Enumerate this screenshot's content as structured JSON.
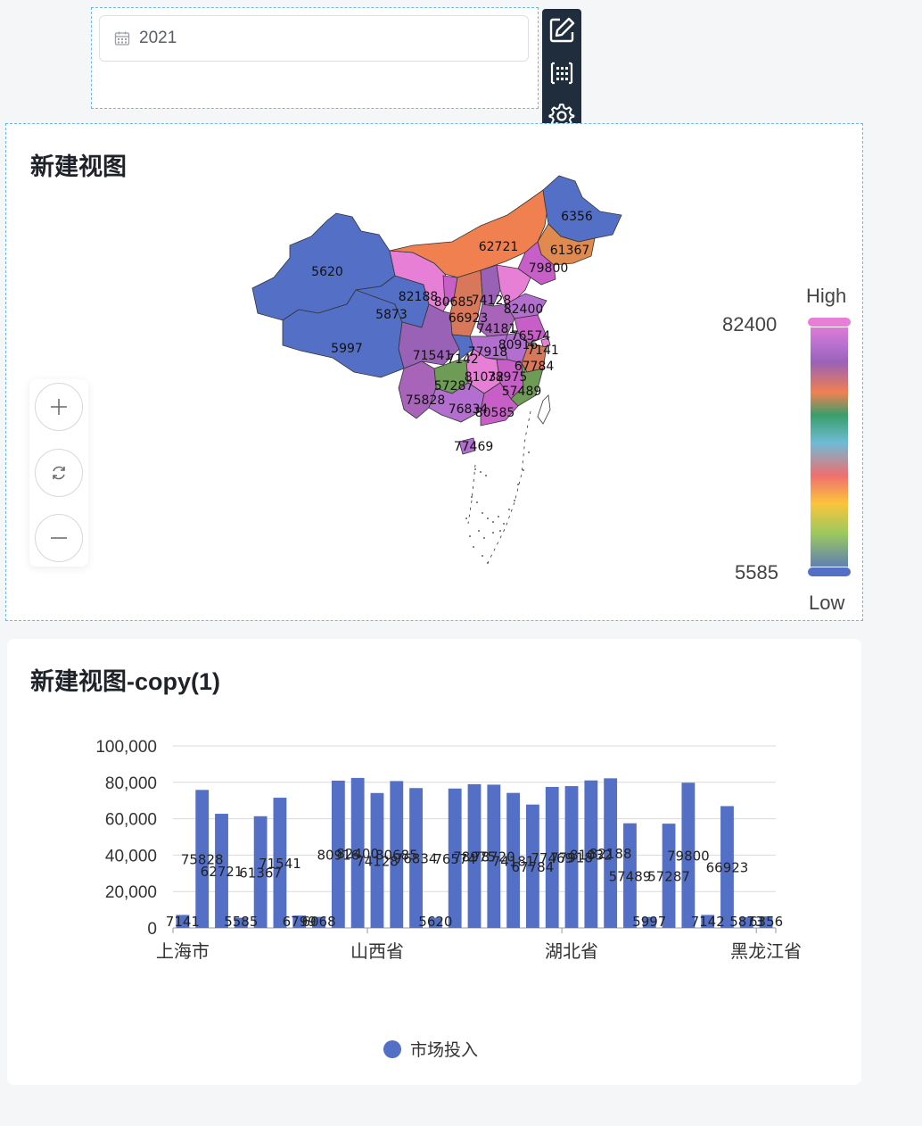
{
  "filter": {
    "date_value": "2021"
  },
  "map_card": {
    "title": "新建视图",
    "visual_map": {
      "high_label": "High",
      "low_label": "Low",
      "max": "82400",
      "min": "5585"
    },
    "region_labels": [
      {
        "text": "6356",
        "fill": "#5470c6"
      },
      {
        "text": "62721",
        "fill": "#f08050"
      },
      {
        "text": "61367",
        "fill": "#e08a50"
      },
      {
        "text": "79800",
        "fill": "#c85fc8"
      },
      {
        "text": "5620",
        "fill": "#5470c6"
      },
      {
        "text": "82188",
        "fill": "#e87fd6"
      },
      {
        "text": "5873",
        "fill": "#5470c6"
      },
      {
        "text": "80685",
        "fill": "#c85fc8"
      },
      {
        "text": "74128",
        "fill": "#9a62b6"
      },
      {
        "text": "66923",
        "fill": "#d9775a"
      },
      {
        "text": "82400",
        "fill": "#e87fd6"
      },
      {
        "text": "5997",
        "fill": "#5470c6"
      },
      {
        "text": "74181",
        "fill": "#a864b8"
      },
      {
        "text": "76574",
        "fill": "#b36fcf"
      },
      {
        "text": "80916",
        "fill": "#c85fc8"
      },
      {
        "text": "7141",
        "fill": "#e87fd6"
      },
      {
        "text": "71541",
        "fill": "#9a62b6"
      },
      {
        "text": "7142",
        "fill": "#5470c6"
      },
      {
        "text": "77918",
        "fill": "#b36fcf"
      },
      {
        "text": "67784",
        "fill": "#d9775a"
      },
      {
        "text": "57287",
        "fill": "#6e9b55"
      },
      {
        "text": "81032",
        "fill": "#e87fd6"
      },
      {
        "text": "78975",
        "fill": "#c85fc8"
      },
      {
        "text": "57489",
        "fill": "#6e9b55"
      },
      {
        "text": "75828",
        "fill": "#a864b8"
      },
      {
        "text": "76834",
        "fill": "#b36fcf"
      },
      {
        "text": "80585",
        "fill": "#c85fc8"
      },
      {
        "text": "77469",
        "fill": "#b36fcf"
      }
    ]
  },
  "bar_card": {
    "title": "新建视图-copy(1)",
    "legend": "市场投入"
  },
  "chart_data": {
    "type": "bar",
    "categories": [
      "上海市",
      "",
      "",
      "",
      "",
      "",
      "",
      "",
      "",
      "",
      "山西省",
      "",
      "",
      "",
      "",
      "",
      "",
      "",
      "",
      "",
      "湖北省",
      "",
      "",
      "",
      "",
      "",
      "",
      "",
      "",
      "",
      "黑龙江省"
    ],
    "series": [
      {
        "name": "市场投入",
        "values": [
          7141,
          75828,
          62721,
          5585,
          61367,
          71541,
          6799,
          6068,
          80916,
          82400,
          74128,
          80685,
          76834,
          5620,
          76574,
          78975,
          78720,
          74181,
          67784,
          77469,
          77918,
          81032,
          82188,
          57489,
          5997,
          57287,
          79800,
          7142,
          66923,
          5873,
          6356
        ]
      }
    ],
    "value_labels": [
      "7141",
      "75828",
      "62721",
      "5585",
      "61367",
      "71541",
      "6799",
      "6068",
      "80916",
      "82400",
      "74128",
      "80685",
      "76834",
      "5620",
      "76574",
      "78975",
      "78720",
      "74181",
      "67784",
      "77469",
      "77918",
      "81032",
      "82188",
      "57489",
      "5997",
      "57287",
      "79800",
      "7142",
      "66923",
      "5873",
      "6356"
    ],
    "y_ticks": [
      "0",
      "20,000",
      "40,000",
      "60,000",
      "80,000",
      "100,000"
    ],
    "ylim": [
      0,
      100000
    ],
    "grid": true,
    "legend_position": "bottom",
    "colors": {
      "bar": "#5470c6"
    }
  }
}
